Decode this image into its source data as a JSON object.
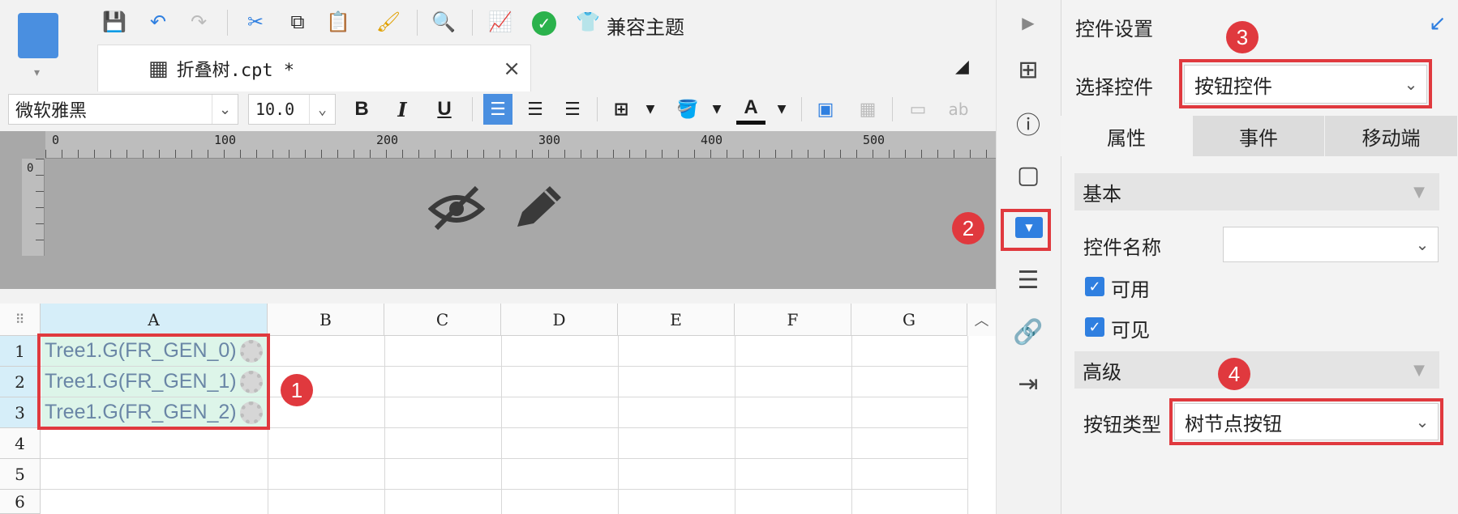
{
  "toolbar": {
    "compat_theme": "兼容主题",
    "icons": [
      "save-icon",
      "undo-icon",
      "redo-icon",
      "cut-icon",
      "copy-icon",
      "paste-icon",
      "format-brush-icon",
      "text-search-icon",
      "chart-search-icon",
      "check-icon",
      "theme-icon"
    ]
  },
  "tab": {
    "title": "折叠树.cpt *",
    "close": "×"
  },
  "format": {
    "font": "微软雅黑",
    "size": "10.0",
    "bold": "B",
    "italic": "I",
    "underline": "U",
    "text_color_glyph": "A",
    "ab": "ab"
  },
  "ruler": {
    "top_ticks": [
      "0",
      "100",
      "200",
      "300",
      "400",
      "500"
    ],
    "left_tick": "0"
  },
  "grid": {
    "columns": [
      "A",
      "B",
      "C",
      "D",
      "E",
      "F",
      "G"
    ],
    "rows": [
      "1",
      "2",
      "3",
      "4",
      "5",
      "6"
    ],
    "cells": [
      "Tree1.G(FR_GEN_0)",
      "Tree1.G(FR_GEN_1)",
      "Tree1.G(FR_GEN_2)"
    ]
  },
  "panel": {
    "title": "控件设置",
    "select_label": "选择控件",
    "select_value": "按钮控件",
    "tabs": [
      "属性",
      "事件",
      "移动端"
    ],
    "basic": "基本",
    "name_label": "控件名称",
    "enabled": "可用",
    "visible": "可见",
    "advanced": "高级",
    "button_type_label": "按钮类型",
    "button_type_value": "树节点按钮"
  },
  "badges": [
    "1",
    "2",
    "3",
    "4"
  ],
  "colors": {
    "accent": "#2f7fe0",
    "badge": "#e0393e",
    "cell_bg": "#ddf5e9"
  }
}
